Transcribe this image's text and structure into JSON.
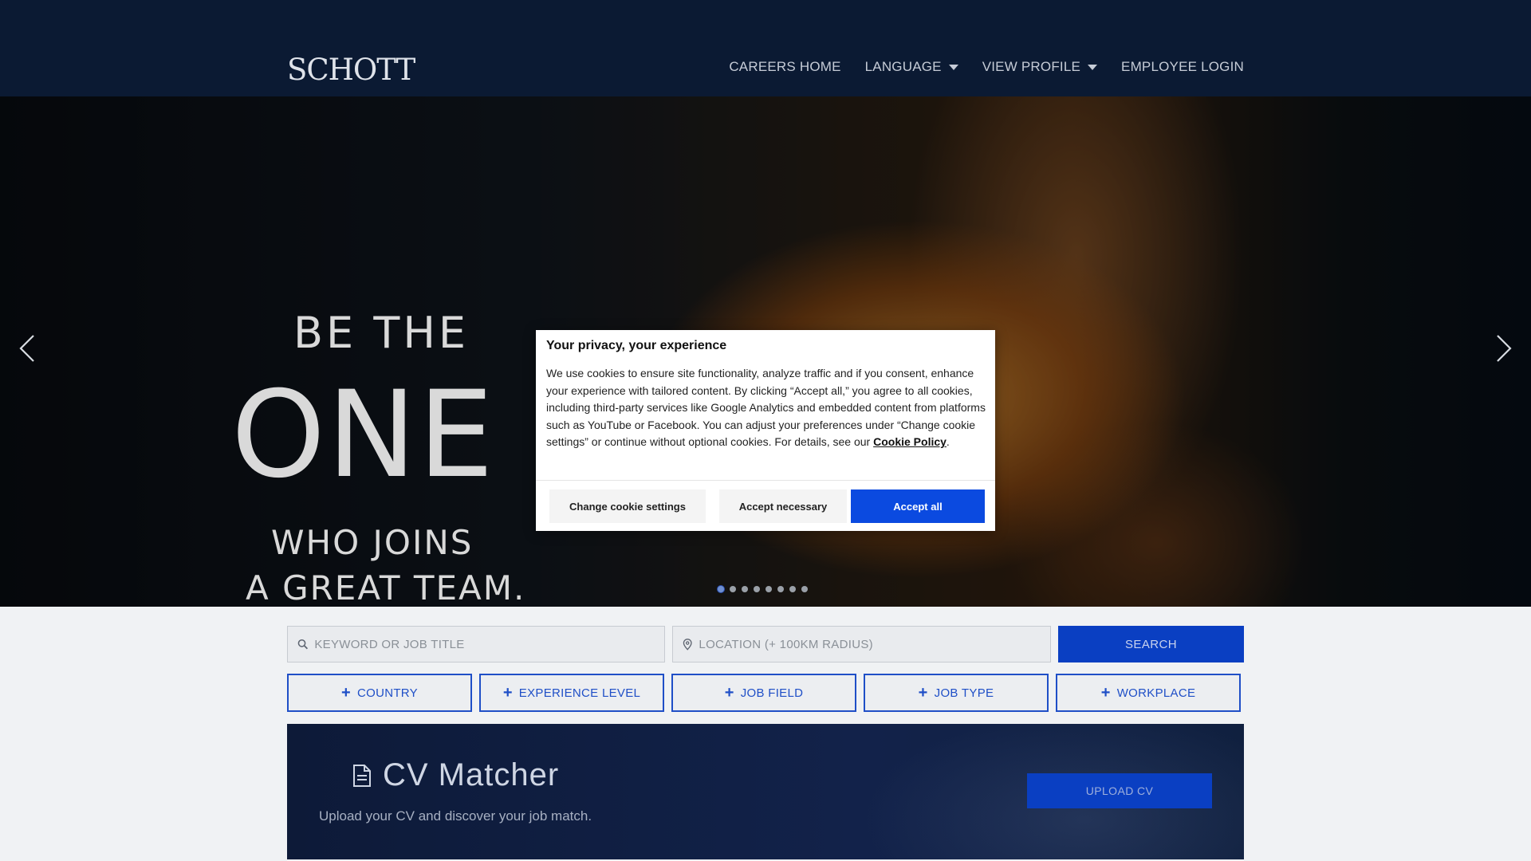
{
  "header": {
    "logo": "SCHOTT",
    "nav": {
      "careers_home": "CAREERS HOME",
      "language": "LANGUAGE",
      "view_profile": "VIEW PROFILE",
      "employee_login": "EMPLOYEE LOGIN"
    }
  },
  "hero": {
    "line1": "BE THE",
    "line2": "ONE",
    "line3": "WHO JOINS",
    "line4": "A GREAT TEAM.",
    "slide_count": 8,
    "active_slide": 1
  },
  "search": {
    "keyword_placeholder": "KEYWORD OR JOB TITLE",
    "location_placeholder": "LOCATION (+ 100KM RADIUS)",
    "button": "SEARCH"
  },
  "filters": {
    "country": "COUNTRY",
    "experience_level": "EXPERIENCE LEVEL",
    "job_field": "JOB FIELD",
    "job_type": "JOB TYPE",
    "workplace": "WORKPLACE"
  },
  "cv_matcher": {
    "title": "CV Matcher",
    "subtitle": "Upload your CV and discover your job match.",
    "button": "UPLOAD CV"
  },
  "cookie_modal": {
    "title": "Your privacy, your experience",
    "body": "We use cookies to ensure site functionality, analyze traffic and if you consent, enhance your experience with tailored content. By clicking “Accept all,” you agree to all cookies, including third-party services like Google Analytics and embedded content from platforms such as YouTube or Facebook. You can adjust your preferences under “Change cookie settings” or continue without optional cookies. For details, see our",
    "link": "Cookie Policy",
    "link_suffix": ".",
    "change_settings": "Change cookie settings",
    "accept_necessary": "Accept necessary",
    "accept_all": "Accept all"
  },
  "colors": {
    "header_bg": "#0b1a33",
    "brand_blue": "#0a3fc2",
    "accept_blue": "#0b4ae0",
    "filter_border": "#1f4fc7"
  }
}
